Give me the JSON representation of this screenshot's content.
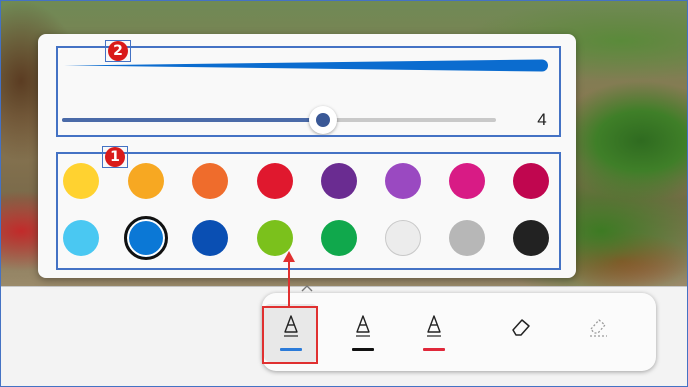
{
  "flyout": {
    "size_value": "4",
    "size_level_of_max": 0.6,
    "colors": [
      {
        "name": "yellow",
        "hex": "#ffd230"
      },
      {
        "name": "gold",
        "hex": "#f7a822"
      },
      {
        "name": "orange",
        "hex": "#ef6c2c"
      },
      {
        "name": "red",
        "hex": "#e0182e"
      },
      {
        "name": "dark-purple",
        "hex": "#6a2c91"
      },
      {
        "name": "purple",
        "hex": "#9a49c1"
      },
      {
        "name": "magenta",
        "hex": "#d81b85"
      },
      {
        "name": "crimson",
        "hex": "#c0064f"
      },
      {
        "name": "light-blue",
        "hex": "#4ac8f2"
      },
      {
        "name": "blue",
        "hex": "#0b78d6",
        "selected": true
      },
      {
        "name": "dark-blue",
        "hex": "#0a4fb3"
      },
      {
        "name": "green",
        "hex": "#7bc11c"
      },
      {
        "name": "emerald",
        "hex": "#10a84c"
      },
      {
        "name": "white",
        "hex": "#ececec"
      },
      {
        "name": "gray",
        "hex": "#b7b7b7"
      },
      {
        "name": "black",
        "hex": "#222222"
      }
    ]
  },
  "annotations": {
    "badge_1": "1",
    "badge_2": "2"
  },
  "toolbar": {
    "tools": [
      {
        "name": "ballpoint-pen",
        "icon": "pen-icon",
        "underline": "#2b7bd9",
        "active": true
      },
      {
        "name": "pencil",
        "icon": "pen-icon",
        "underline": "#111111",
        "active": false
      },
      {
        "name": "highlighter",
        "icon": "pen-icon",
        "underline": "#e0283a",
        "active": false
      },
      {
        "name": "eraser",
        "icon": "eraser-icon",
        "active": false
      },
      {
        "name": "clear-all",
        "icon": "clear-eraser-icon",
        "active": false
      }
    ]
  },
  "colors": {
    "annotation_blue": "#4472c4",
    "annotation_red": "#e03030",
    "thickness_blue": "#0b6ccf"
  }
}
